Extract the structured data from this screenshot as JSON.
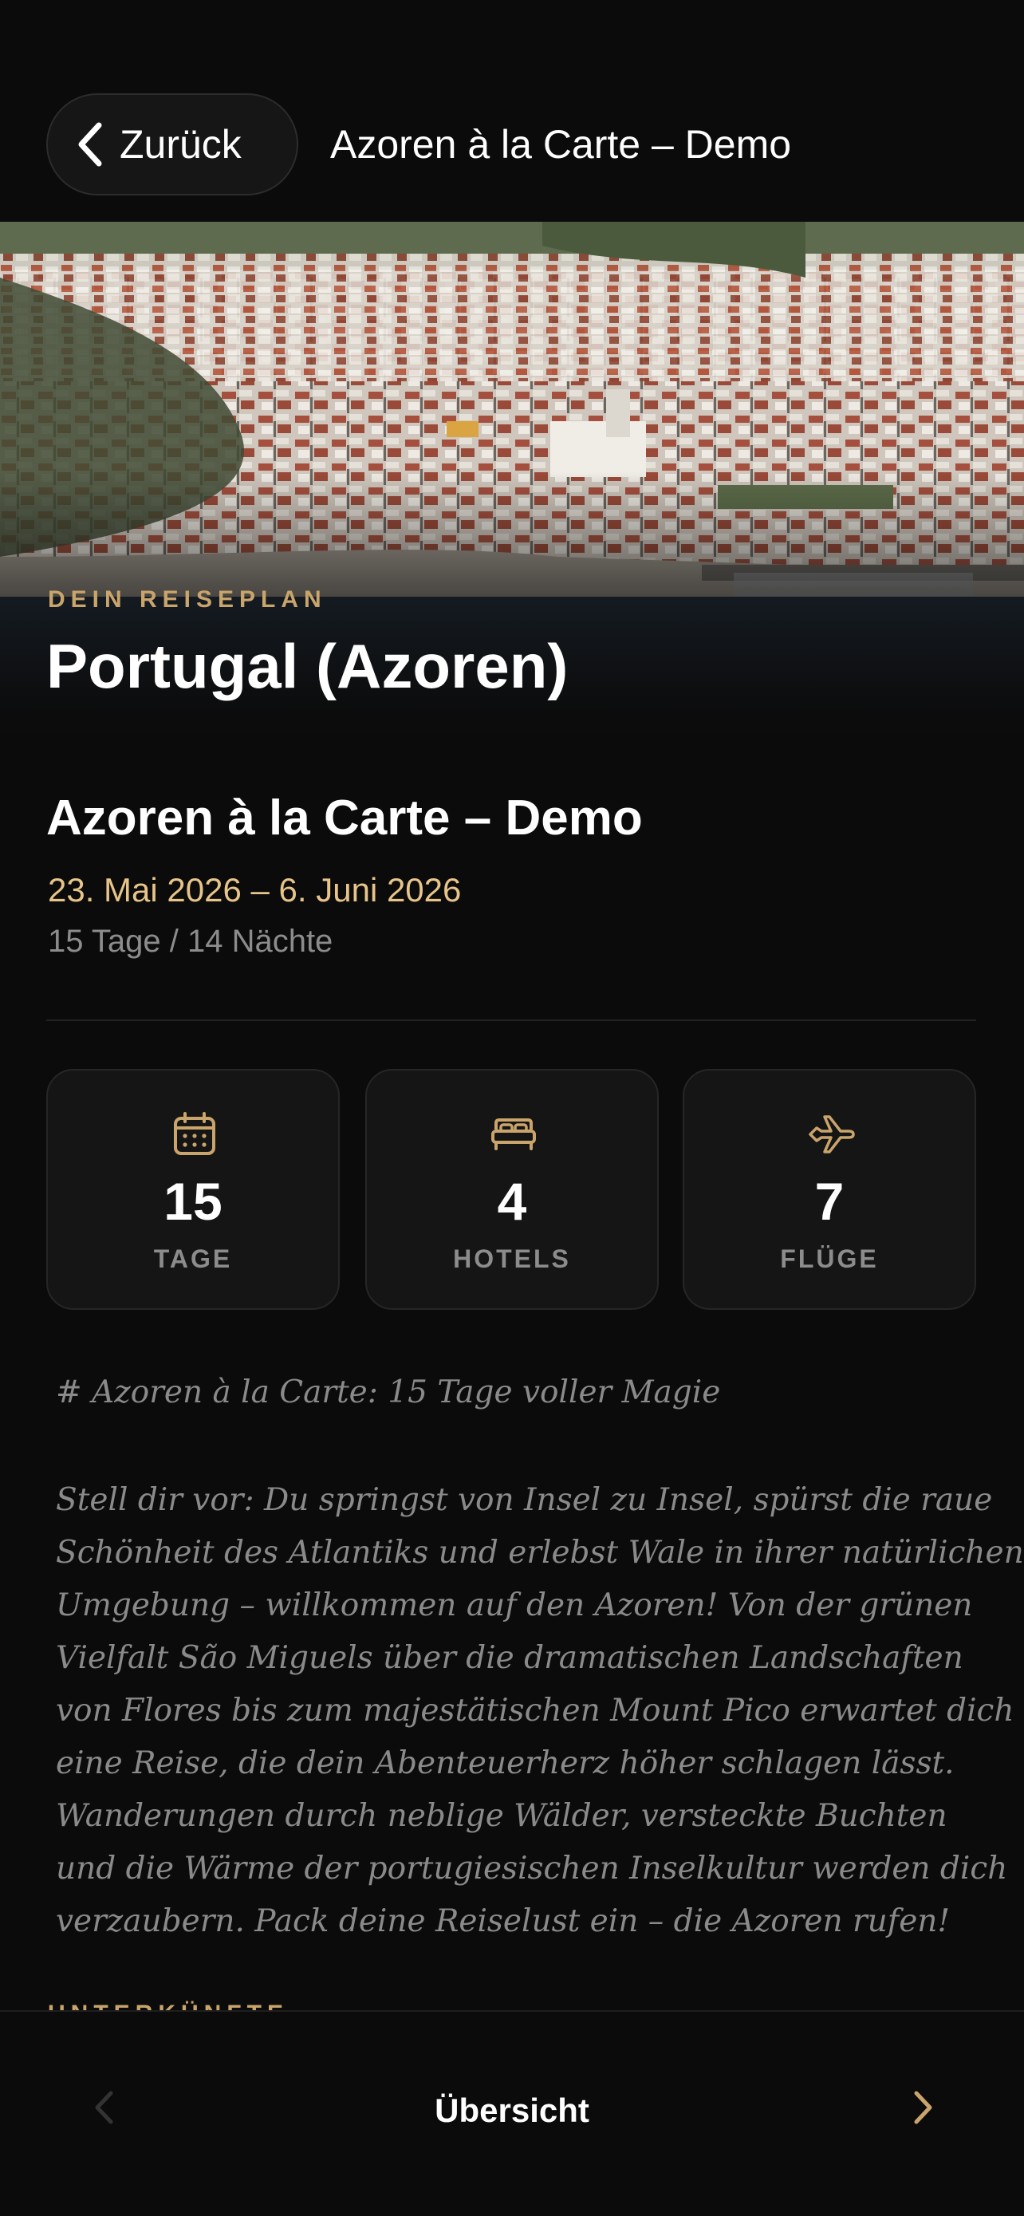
{
  "header": {
    "back_label": "Zurück",
    "title": "Azoren à la Carte – Demo"
  },
  "hero": {
    "eyebrow": "DEIN REISEPLAN",
    "title": "Portugal (Azoren)"
  },
  "trip": {
    "name": "Azoren à la Carte – Demo",
    "dates": "23. Mai 2026 – 6. Juni 2026",
    "duration": "15 Tage / 14 Nächte"
  },
  "stats": [
    {
      "icon": "calendar-icon",
      "value": "15",
      "label": "TAGE"
    },
    {
      "icon": "bed-icon",
      "value": "4",
      "label": "HOTELS"
    },
    {
      "icon": "airplane-icon",
      "value": "7",
      "label": "FLÜGE"
    }
  ],
  "description": {
    "heading": "# Azoren à la Carte: 15 Tage voller Magie",
    "lines": [
      "Stell dir vor: Du springst von Insel zu Insel, spürst die raue",
      "Schönheit des Atlantiks und erlebst Wale in ihrer natürlichen",
      "Umgebung – willkommen auf den Azoren! Von der grünen",
      "Vielfalt São Miguels über die dramatischen Landschaften",
      "von Flores bis zum majestätischen Mount Pico erwartet dich",
      "eine Reise, die dein Abenteuerherz höher schlagen lässt.",
      "Wanderungen durch neblige Wälder, versteckte Buchten",
      "und die Wärme der portugiesischen Inselkultur werden dich",
      "verzaubern. Pack deine Reiselust ein – die Azoren rufen!"
    ]
  },
  "next_section_label": "UNTERKÜNFTE",
  "bottom_nav": {
    "title": "Übersicht"
  },
  "colors": {
    "background": "#0b0b0b",
    "accent": "#c9a46b",
    "dates": "#e7c48a",
    "muted": "#8c8c8c"
  }
}
